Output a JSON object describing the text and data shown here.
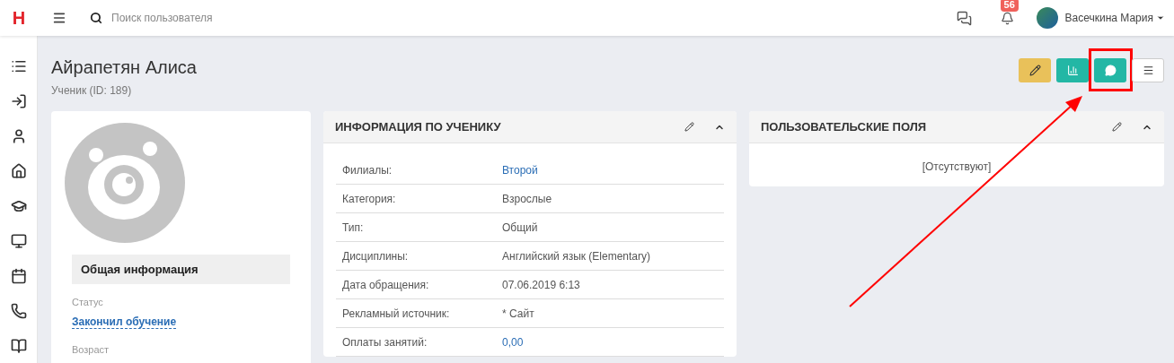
{
  "header": {
    "logo": "H",
    "search": {
      "placeholder": "Поиск пользователя"
    },
    "notifications_badge": "56",
    "user_name": "Васечкина Мария"
  },
  "page": {
    "title": "Айрапетян Алиса",
    "subtitle": "Ученик (ID: 189)"
  },
  "toolbar": [
    {
      "kind": "edit",
      "highlighted": false
    },
    {
      "kind": "stats",
      "highlighted": false
    },
    {
      "kind": "comment",
      "highlighted": true
    },
    {
      "kind": "menu",
      "highlighted": false
    }
  ],
  "profile_card": {
    "section_title": "Общая информация",
    "fields": [
      {
        "label": "Статус",
        "value": "Закончил обучение"
      },
      {
        "label": "Возраст"
      }
    ]
  },
  "student_info": {
    "title": "ИНФОРМАЦИЯ ПО УЧЕНИКУ",
    "rows": [
      {
        "label": "Филиалы:",
        "value": "Второй",
        "link": true
      },
      {
        "label": "Категория:",
        "value": "Взрослые",
        "link": false
      },
      {
        "label": "Тип:",
        "value": "Общий",
        "link": false
      },
      {
        "label": "Дисциплины:",
        "value": "Английский язык (Elementary)",
        "link": false
      },
      {
        "label": "Дата обращения:",
        "value": "07.06.2019 6:13",
        "link": false
      },
      {
        "label": "Рекламный источник:",
        "value": "* Сайт",
        "link": false
      },
      {
        "label": "Оплаты занятий:",
        "value": "0,00",
        "link": true
      }
    ]
  },
  "custom_fields": {
    "title": "ПОЛЬЗОВАТЕЛЬСКИЕ ПОЛЯ",
    "empty_text": "[Отсутствуют]"
  }
}
